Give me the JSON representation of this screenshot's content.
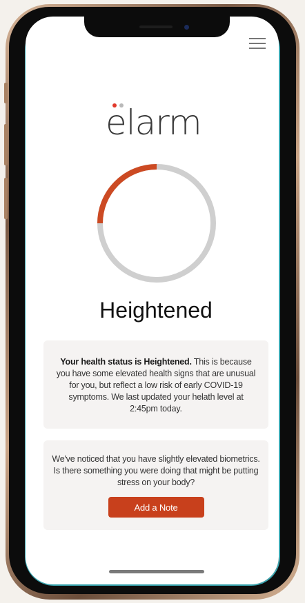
{
  "header": {
    "menu_icon": "hamburger-menu-icon"
  },
  "brand": {
    "logo_text": "elarm",
    "dot_colors": [
      "#e1392b",
      "#b9b9b9"
    ]
  },
  "status": {
    "label": "Heightened",
    "progress_fraction": 0.25,
    "accent_color": "#cc4a23",
    "track_color": "#cfcfcf"
  },
  "info_card": {
    "bold_text": "Your health status is Heightened.",
    "body_text": " This is because you have some elevated health signs that are unusual for you, but reflect a low risk of early COVID-19 symptoms. We last updated your helath level at 2:45pm today."
  },
  "note_card": {
    "text": "We've noticed that you have slightly elevated biometrics. Is there something you were doing that might be putting stress on your body?",
    "button_label": "Add a Note",
    "button_color": "#c8401c"
  }
}
